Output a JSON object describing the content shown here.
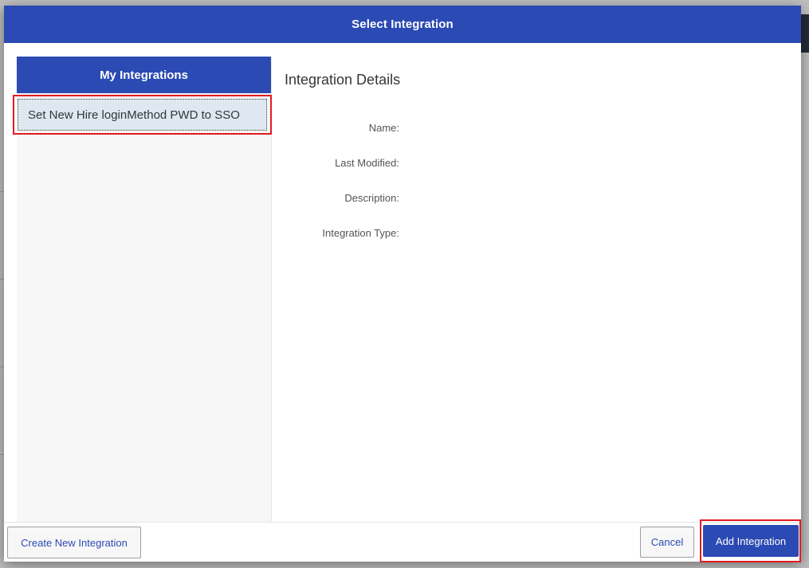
{
  "dialog": {
    "title": "Select Integration"
  },
  "left_panel": {
    "header": "My Integrations",
    "items": [
      {
        "label": "Set New Hire loginMethod PWD to SSO"
      }
    ]
  },
  "details": {
    "title": "Integration Details",
    "fields": [
      {
        "label": "Name:"
      },
      {
        "label": "Last Modified:"
      },
      {
        "label": "Description:"
      },
      {
        "label": "Integration Type:"
      }
    ]
  },
  "footer": {
    "create_label": "Create New Integration",
    "cancel_label": "Cancel",
    "add_label": "Add Integration"
  },
  "colors": {
    "accent": "#2b4ab3",
    "highlight_border": "#e21b23",
    "selected_item_bg": "#dfe8f0"
  }
}
